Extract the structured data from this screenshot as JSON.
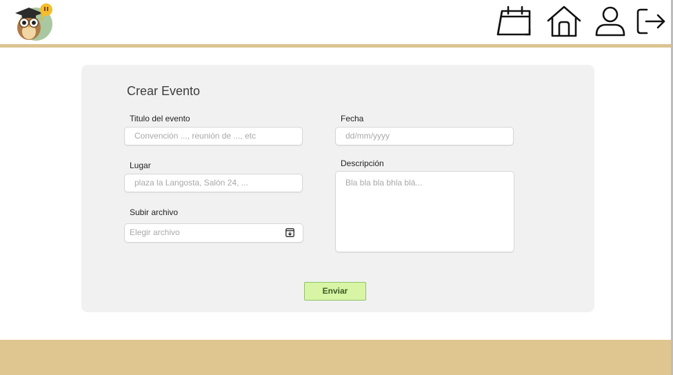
{
  "header": {
    "nav": [
      {
        "icon": "calendar-icon"
      },
      {
        "icon": "home-icon"
      },
      {
        "icon": "user-icon"
      },
      {
        "icon": "logout-icon"
      }
    ]
  },
  "form": {
    "title": "Crear Evento",
    "event_title": {
      "label": "Titulo del evento",
      "placeholder": "Convención ..., reunión de ..., etc"
    },
    "date": {
      "label": "Fecha",
      "placeholder": "dd/mm/yyyy"
    },
    "place": {
      "label": "Lugar",
      "placeholder": "plaza la Langosta, Salón 24, ..."
    },
    "description": {
      "label": "Descripción",
      "placeholder": "Bla bla bla bhla blá..."
    },
    "upload": {
      "label": "Subir archivo",
      "placeholder": "Elegir archivo"
    },
    "submit_label": "Enviar"
  },
  "colors": {
    "accent_band": "#dfc58f",
    "submit_bg": "#d7f5a5",
    "card_bg": "#f1f1f1"
  }
}
